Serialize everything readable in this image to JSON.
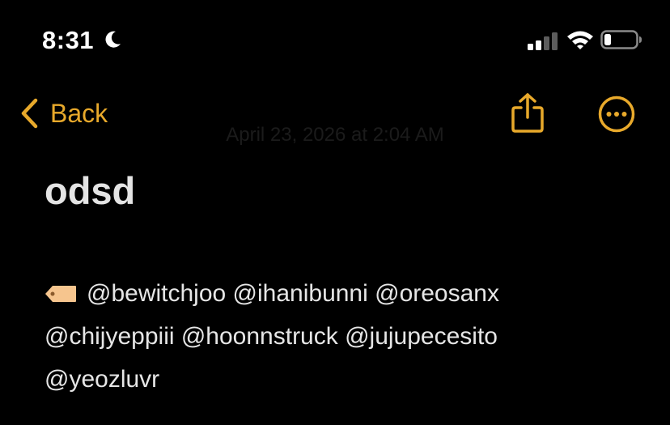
{
  "status_bar": {
    "time": "8:31",
    "focus_icon": "moon-icon",
    "signal_icon": "cellular-signal-icon",
    "wifi_icon": "wifi-icon",
    "battery_icon": "battery-icon",
    "battery_level": 0.2
  },
  "nav": {
    "back_label": "Back",
    "share_icon": "share-icon",
    "more_icon": "ellipsis-circle-icon",
    "accent_color": "#e8a92b"
  },
  "note": {
    "date": "April 23, 2026 at 2:04 AM",
    "title": "odsd",
    "tag_emoji_icon": "label-tag-icon",
    "body_lines": [
      "@bewitchjoo @ihanibunni @oreosanx",
      "@chijyeppiii @hoonnstruck @jujupecesito",
      "@yeozluvr"
    ]
  }
}
